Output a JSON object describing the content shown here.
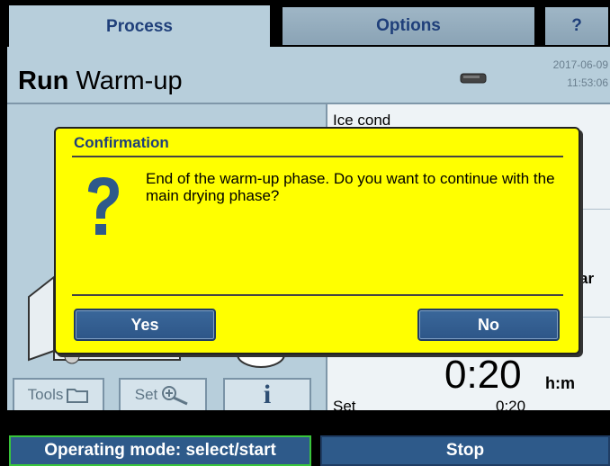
{
  "tabs": {
    "process": "Process",
    "options": "Options",
    "help": "?"
  },
  "header": {
    "run_word": "Run",
    "phase": "Warm-up",
    "date": "2017-06-09",
    "time": "11:53:06"
  },
  "data_panel": {
    "ice_cond_label": "Ice cond",
    "unit_partial": "ar",
    "time_value": "0:20",
    "time_unit": "h:m",
    "set_label": "Set",
    "set_value": "0:20"
  },
  "tools": {
    "tools_label": "Tools",
    "set_label": "Set",
    "info_label": "i"
  },
  "dialog": {
    "title": "Confirmation",
    "message": "End of the warm-up phase. Do you want to continue with the main drying phase?",
    "yes": "Yes",
    "no": "No"
  },
  "bottom": {
    "mode": "Operating mode: select/start",
    "stop": "Stop"
  },
  "colors": {
    "accent_yellow": "#ffff00",
    "button_blue": "#2e5a8a",
    "panel_bg": "#b7cedb",
    "status_green": "#39c43b"
  }
}
